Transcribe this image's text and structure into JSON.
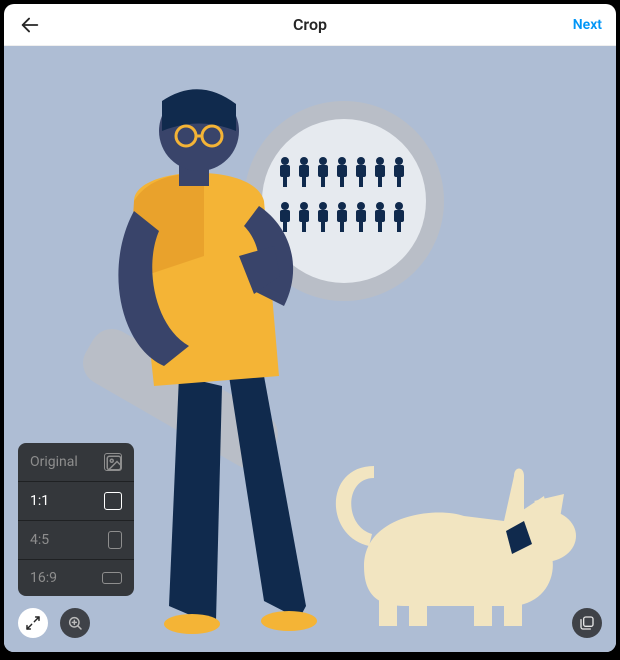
{
  "header": {
    "title": "Crop",
    "next_label": "Next"
  },
  "ratio_menu": {
    "items": [
      {
        "label": "Original",
        "shape": "image",
        "selected": false
      },
      {
        "label": "1:1",
        "shape": "11",
        "selected": true
      },
      {
        "label": "4:5",
        "shape": "45",
        "selected": false
      },
      {
        "label": "16:9",
        "shape": "169",
        "selected": false
      }
    ]
  },
  "colors": {
    "accent": "#0095f6",
    "canvas_bg": "#aebdd4",
    "person_skin": "#39446a",
    "shirt": "#f4b436",
    "pants": "#102a4d",
    "cat": "#f2e5c1",
    "collar": "#102a4d"
  }
}
